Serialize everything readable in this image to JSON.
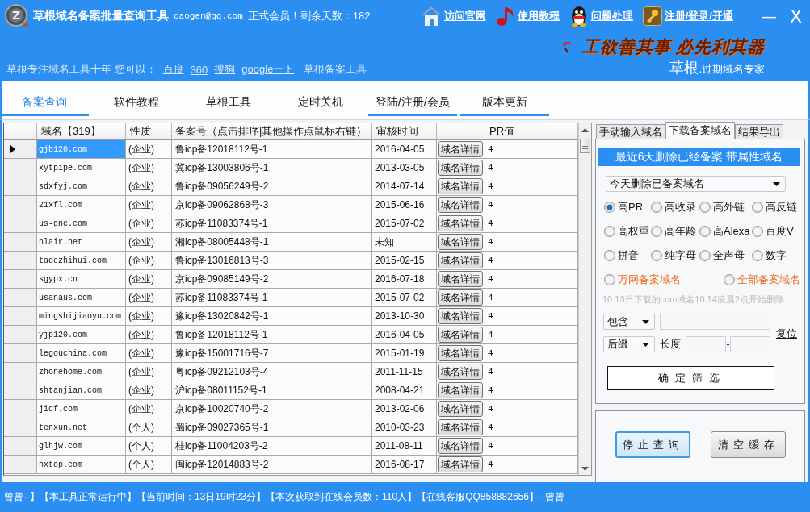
{
  "window": {
    "logo": "Z",
    "title": "草根域名备案批量查询工具",
    "account": "caogen@qq.com",
    "membership": "正式会员！剩余天数：182",
    "controls": [
      "—",
      "X"
    ]
  },
  "top_links": [
    "访问官网",
    "使用教程",
    "问题处理",
    "注册/登录/开通"
  ],
  "banner": {
    "slogan": "工欲善其事 必先利其器",
    "brand": "草根",
    "tagline": ".过期域名专家"
  },
  "quick_links": {
    "intro": "草根专注域名工具十年 您可以：",
    "links": [
      "百度",
      "360",
      "搜狗",
      "google一下"
    ],
    "extra": "草根备案工具"
  },
  "tabs": [
    {
      "label": "备案查询",
      "selected": true,
      "underlined": true
    },
    {
      "label": "软件教程",
      "selected": false,
      "underlined": false
    },
    {
      "label": "草根工具",
      "selected": false,
      "underlined": false
    },
    {
      "label": "定时关机",
      "selected": false,
      "underlined": false
    },
    {
      "label": "登陆/注册/会员",
      "selected": false,
      "underlined": true
    },
    {
      "label": "版本更新",
      "selected": false,
      "underlined": true
    }
  ],
  "table": {
    "columns": [
      "域名【319】",
      "性质",
      "备案号（点击排序|其他操作点鼠标右键）",
      "审核时间",
      "PR值"
    ],
    "rows": [
      {
        "domain": "gjb120.com",
        "type": "(企业)",
        "icp": "鲁icp备12018112号-1",
        "date": "2016-04-05",
        "action": "域名详情",
        "pr": "4",
        "selected": true
      },
      {
        "domain": "xytpipe.com",
        "type": "(企业)",
        "icp": "冀icp备13003806号-1",
        "date": "2013-03-05",
        "action": "域名详情",
        "pr": "4",
        "selected": false
      },
      {
        "domain": "sdxfyj.com",
        "type": "(企业)",
        "icp": "鲁icp备09056249号-2",
        "date": "2014-07-14",
        "action": "域名详情",
        "pr": "4",
        "selected": false
      },
      {
        "domain": "21xfl.com",
        "type": "(企业)",
        "icp": "京icp备09062868号-3",
        "date": "2015-06-16",
        "action": "域名详情",
        "pr": "4",
        "selected": false
      },
      {
        "domain": "us-gnc.com",
        "type": "(企业)",
        "icp": "苏icp备11083374号-1",
        "date": "2015-07-02",
        "action": "域名详情",
        "pr": "4",
        "selected": false
      },
      {
        "domain": "hlair.net",
        "type": "(企业)",
        "icp": "湘icp备08005448号-1",
        "date": "未知",
        "action": "域名详情",
        "pr": "4",
        "selected": false
      },
      {
        "domain": "tadezhihui.com",
        "type": "(企业)",
        "icp": "鲁icp备13016813号-3",
        "date": "2015-02-15",
        "action": "域名详情",
        "pr": "4",
        "selected": false
      },
      {
        "domain": "sgypx.cn",
        "type": "(企业)",
        "icp": "京icp备09085149号-2",
        "date": "2016-07-18",
        "action": "域名详情",
        "pr": "4",
        "selected": false
      },
      {
        "domain": "usanaus.com",
        "type": "(企业)",
        "icp": "苏icp备11083374号-1",
        "date": "2015-07-02",
        "action": "域名详情",
        "pr": "4",
        "selected": false
      },
      {
        "domain": "mingshijiaoyu.com",
        "type": "(企业)",
        "icp": "豫icp备13020842号-1",
        "date": "2013-10-30",
        "action": "域名详情",
        "pr": "4",
        "selected": false
      },
      {
        "domain": "yjp120.com",
        "type": "(企业)",
        "icp": "鲁icp备12018112号-1",
        "date": "2016-04-05",
        "action": "域名详情",
        "pr": "4",
        "selected": false
      },
      {
        "domain": "legouchina.com",
        "type": "(企业)",
        "icp": "豫icp备15001716号-7",
        "date": "2015-01-19",
        "action": "域名详情",
        "pr": "4",
        "selected": false
      },
      {
        "domain": "zhonehome.com",
        "type": "(企业)",
        "icp": "粤icp备09212103号-4",
        "date": "2011-11-15",
        "action": "域名详情",
        "pr": "4",
        "selected": false
      },
      {
        "domain": "shtanjian.com",
        "type": "(企业)",
        "icp": "沪icp备08011152号-1",
        "date": "2008-04-21",
        "action": "域名详情",
        "pr": "4",
        "selected": false
      },
      {
        "domain": "jidf.com",
        "type": "(企业)",
        "icp": "京icp备10020740号-2",
        "date": "2013-02-06",
        "action": "域名详情",
        "pr": "4",
        "selected": false
      },
      {
        "domain": "tenxun.net",
        "type": "(个人)",
        "icp": "蜀icp备09027365号-1",
        "date": "2010-03-23",
        "action": "域名详情",
        "pr": "4",
        "selected": false
      },
      {
        "domain": "glhjw.com",
        "type": "(个人)",
        "icp": "桂icp备11004203号-2",
        "date": "2011-08-11",
        "action": "域名详情",
        "pr": "4",
        "selected": false
      },
      {
        "domain": "nxtop.com",
        "type": "(个人)",
        "icp": "闽icp备12014883号-2",
        "date": "2016-08-17",
        "action": "域名详情",
        "pr": "4",
        "selected": false
      }
    ]
  },
  "side_panel": {
    "tabs": [
      {
        "label": "手动输入域名",
        "selected": false
      },
      {
        "label": "下载备案域名",
        "selected": true
      },
      {
        "label": "结果导出",
        "selected": false
      }
    ],
    "banner": "最近6天删除已经备案 带属性域名",
    "list_select": "今天删除已备案域名",
    "attributes": [
      {
        "label": "高PR",
        "selected": true
      },
      {
        "label": "高收录",
        "selected": false
      },
      {
        "label": "高外链",
        "selected": false
      },
      {
        "label": "高反链",
        "selected": false
      },
      {
        "label": "高权重",
        "selected": false
      },
      {
        "label": "高年龄",
        "selected": false
      },
      {
        "label": "高Alexa",
        "selected": false
      },
      {
        "label": "百度V",
        "selected": false
      },
      {
        "label": "拼音",
        "selected": false
      },
      {
        "label": "纯字母",
        "selected": false
      },
      {
        "label": "全声母",
        "selected": false
      },
      {
        "label": "数字",
        "selected": false
      }
    ],
    "sources": [
      {
        "label": "万网备案域名",
        "selected": false
      },
      {
        "label": "全部备案域名",
        "selected": false
      }
    ],
    "note": "10.13日下载的com域名10.14凌晨2点开始删除",
    "match_select": "包含",
    "position_select": "后缀",
    "length_label": "长度",
    "range_separator": "-",
    "reset_link": "复位",
    "confirm_button": "确定筛选",
    "actions": [
      {
        "label": "停止查询",
        "focused": true
      },
      {
        "label": "清空缓存",
        "focused": false
      }
    ]
  },
  "status_bar": "曾曾--】【本工具正常运行中】【当前时间：13日19时23分】【本次获取到在线会员数：110人】【在线客服QQ858882656】--曾曾"
}
